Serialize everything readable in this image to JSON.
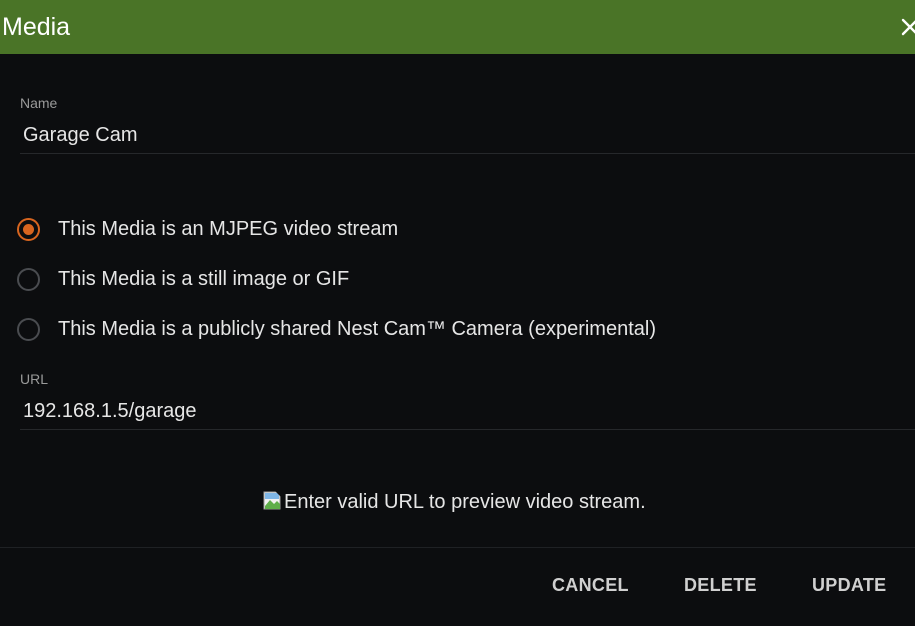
{
  "dialog": {
    "title": "Media",
    "close_icon": "close-icon"
  },
  "name_field": {
    "label": "Name",
    "value": "Garage Cam"
  },
  "media_type": {
    "selected_index": 0,
    "options": [
      {
        "label": "This Media is an MJPEG video stream",
        "checked": true
      },
      {
        "label": "This Media is a still image or GIF",
        "checked": false
      },
      {
        "label": "This Media is a publicly shared Nest Cam™ Camera (experimental)",
        "checked": false
      }
    ]
  },
  "url_field": {
    "label": "URL",
    "value": "192.168.1.5/garage"
  },
  "preview": {
    "icon": "broken-image-icon",
    "text": "Enter valid URL to preview video stream."
  },
  "actions": {
    "cancel_label": "CANCEL",
    "delete_label": "DELETE",
    "update_label": "UPDATE"
  },
  "colors": {
    "titlebar": "#4a7427",
    "accent": "#d8651f",
    "background": "#0c0d0f"
  }
}
